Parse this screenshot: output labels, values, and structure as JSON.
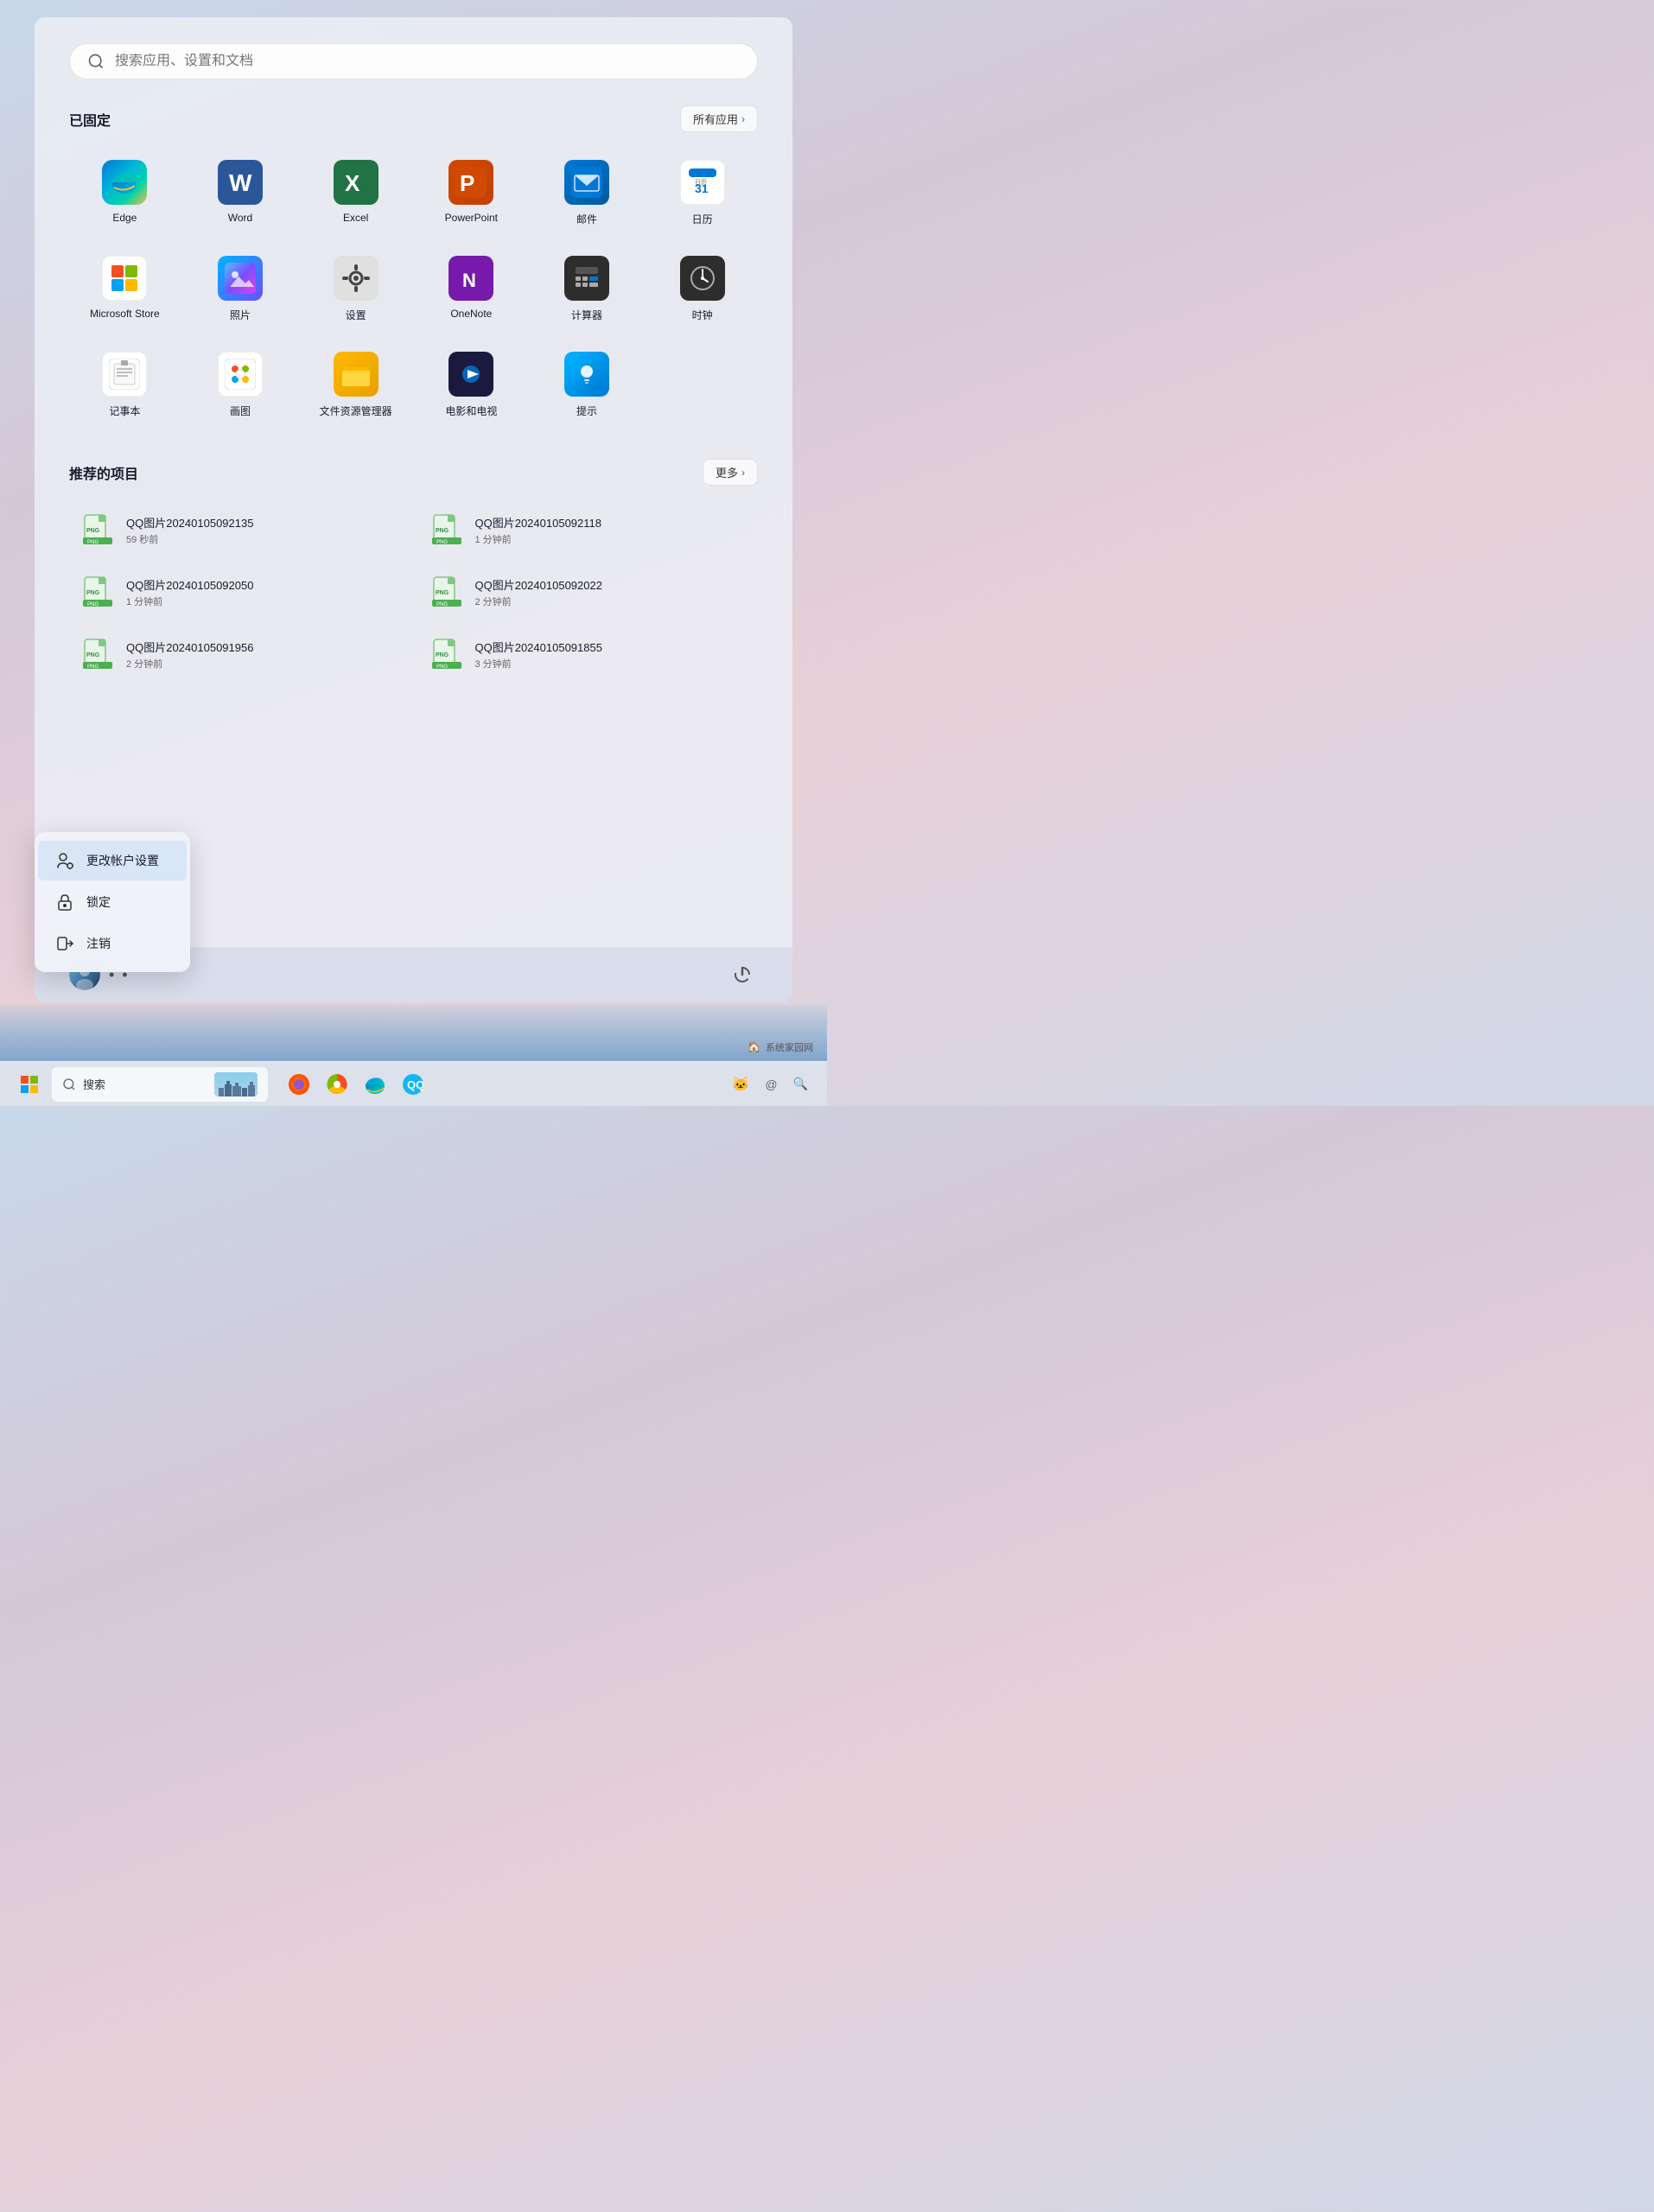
{
  "search": {
    "placeholder": "搜索应用、设置和文档"
  },
  "pinned": {
    "title": "已固定",
    "all_apps_btn": "所有应用",
    "apps": [
      {
        "id": "edge",
        "label": "Edge",
        "icon_type": "edge"
      },
      {
        "id": "word",
        "label": "Word",
        "icon_type": "word"
      },
      {
        "id": "excel",
        "label": "Excel",
        "icon_type": "excel"
      },
      {
        "id": "powerpoint",
        "label": "PowerPoint",
        "icon_type": "ppt"
      },
      {
        "id": "mail",
        "label": "邮件",
        "icon_type": "mail"
      },
      {
        "id": "calendar",
        "label": "日历",
        "icon_type": "calendar"
      },
      {
        "id": "msstore",
        "label": "Microsoft Store",
        "icon_type": "store"
      },
      {
        "id": "photos",
        "label": "照片",
        "icon_type": "photos"
      },
      {
        "id": "settings",
        "label": "设置",
        "icon_type": "settings"
      },
      {
        "id": "onenote",
        "label": "OneNote",
        "icon_type": "onenote"
      },
      {
        "id": "calc",
        "label": "计算器",
        "icon_type": "calc"
      },
      {
        "id": "clock",
        "label": "时钟",
        "icon_type": "clock"
      },
      {
        "id": "notepad",
        "label": "记事本",
        "icon_type": "notepad"
      },
      {
        "id": "paint",
        "label": "画图",
        "icon_type": "paint"
      },
      {
        "id": "explorer",
        "label": "文件资源管理器",
        "icon_type": "explorer"
      },
      {
        "id": "movies",
        "label": "电影和电视",
        "icon_type": "movies"
      },
      {
        "id": "tips",
        "label": "提示",
        "icon_type": "tips"
      }
    ]
  },
  "recommended": {
    "title": "推荐的项目",
    "more_btn": "更多",
    "items": [
      {
        "name": "QQ图片20240105092135",
        "time": "59 秒前"
      },
      {
        "name": "QQ图片20240105092118",
        "time": "1 分钟前"
      },
      {
        "name": "QQ图片20240105092050",
        "time": "1 分钟前"
      },
      {
        "name": "QQ图片20240105092022",
        "time": "2 分钟前"
      },
      {
        "name": "QQ图片20240105091956",
        "time": "2 分钟前"
      },
      {
        "name": "QQ图片20240105091855",
        "time": "3 分钟前"
      }
    ]
  },
  "context_menu": {
    "items": [
      {
        "id": "change-account",
        "label": "更改帐户设置",
        "icon": "person-gear"
      },
      {
        "id": "lock",
        "label": "锁定",
        "icon": "lock"
      },
      {
        "id": "signout",
        "label": "注销",
        "icon": "signout"
      }
    ]
  },
  "taskbar": {
    "search_text": "搜索",
    "apps": [
      "firefox",
      "colorful",
      "edge",
      "qq"
    ]
  },
  "watermark": {
    "text": "系统家园网"
  }
}
